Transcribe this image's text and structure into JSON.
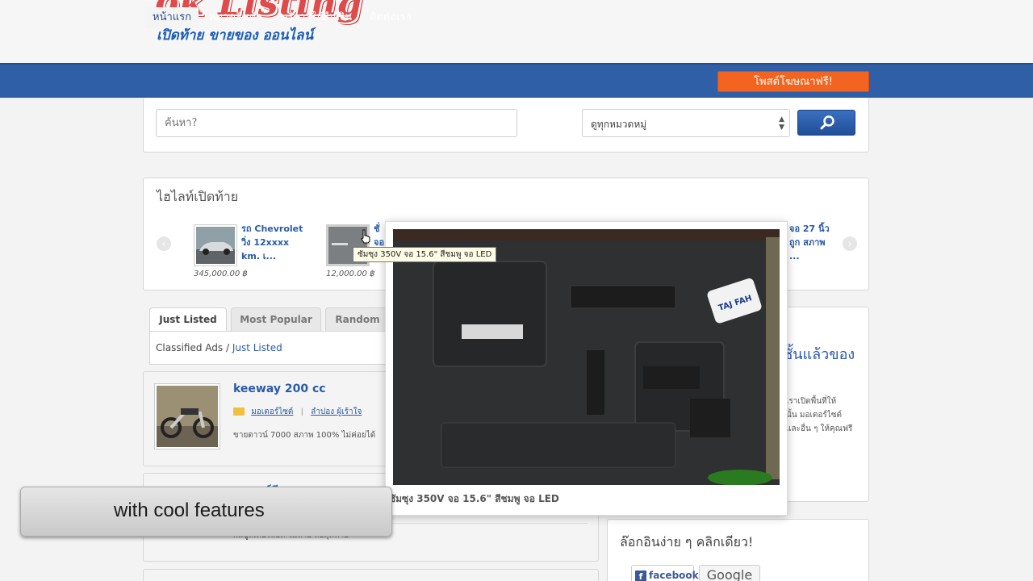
{
  "header": {
    "logo_title": "ok Listing",
    "logo_tagline": "เปิดท้าย ขายของ ออนไลน์"
  },
  "nav": {
    "items": [
      {
        "label": "หน้าแรก",
        "active": true
      },
      {
        "label": "หมวดสินค้า",
        "active": false
      },
      {
        "label": "บริการให้ยืมเงิน",
        "active": false
      },
      {
        "label": "ติดต่อเรา",
        "active": false
      }
    ],
    "post_ad_label": "โพสต์โฆษณาฟรี!"
  },
  "search": {
    "placeholder": "ค้นหา?",
    "category_selected": "ดูทุกหมวดหมู่",
    "search_icon": "magnifier-icon"
  },
  "highlights": {
    "title": "ไฮไลท์เปิดท้าย",
    "items": [
      {
        "line1": "รถ Chevrolet",
        "line2": "วิ่ง 12xxxx",
        "line3": "km. เ...",
        "price": "345,000.00 ฿"
      },
      {
        "line1": "ชั่",
        "line2": "จอ",
        "line3": "",
        "price": "12,000.00 ฿"
      },
      {
        "line1": "จอ 27 นิ้ว",
        "line2": "ถูก สภาพ",
        "line3": "...",
        "price": ""
      }
    ]
  },
  "tabs": [
    {
      "label": "Just Listed",
      "active": true
    },
    {
      "label": "Most Popular",
      "active": false
    },
    {
      "label": "Random",
      "active": false
    }
  ],
  "breadcrumb": {
    "root": "Classified Ads",
    "separator": " / ",
    "current": "Just Listed"
  },
  "listings": [
    {
      "title": "keeway 200 cc",
      "category": "มอเตอร์ไซต์",
      "seller": "ลำปอง ผู้เร้าใจ",
      "snippet": "ขายดาวน์ 7000 สภาพ 100% ไม่ค่อยได้"
    },
    {
      "title": "บูลเตอร์ลีย",
      "category": "",
      "seller": "",
      "snippet": "ผมบูลเตอร์ลียต์ ไม่ลาย ล้อสุดท้าย"
    }
  ],
  "sidebar": {
    "panel1_heading": "ชั้นแล้วของ",
    "panel1_text": [
      "เราเปิดพื้นที่ให้",
      "นั้น มอเตอร์ไซต์",
      "และอื่น ๆ ให้คุณฟรี"
    ],
    "login_title": "ล๊อกอินง่าย ๆ คลิกเดียว!",
    "facebook_label": "facebook",
    "google_label": "Google"
  },
  "tooltip": {
    "text": "ซัมซุง 350V จอ 15.6\" สีชมพู จอ LED"
  },
  "preview": {
    "caption": "ซัมซุง 350V จอ 15.6\" สีชมพู จอ LED",
    "sticker_text": "TAJ FAH"
  },
  "banner": {
    "text": "with cool features"
  },
  "colors": {
    "nav_blue": "#2f5fa6",
    "accent_orange": "#f2641f",
    "link_blue": "#2a5aa8"
  }
}
